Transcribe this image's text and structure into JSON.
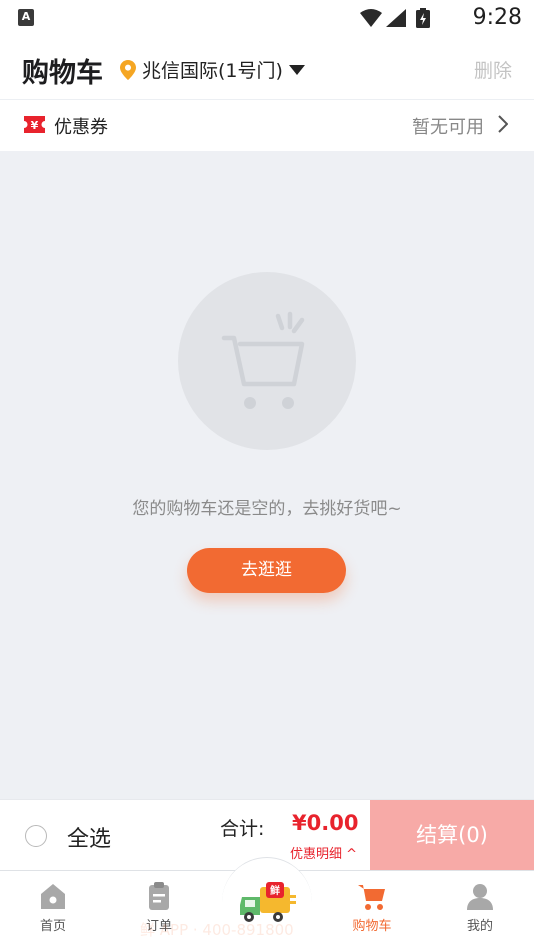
{
  "status_bar": {
    "indicator": "A",
    "time": "9:28"
  },
  "header": {
    "title": "购物车",
    "location": "兆信国际(1号门)",
    "delete_label": "删除"
  },
  "coupon": {
    "badge": "¥",
    "label": "优惠券",
    "status": "暂无可用"
  },
  "empty_state": {
    "message": "您的购物车还是空的，去挑好货吧~",
    "button_label": "去逛逛"
  },
  "checkout": {
    "select_all_label": "全选",
    "total_label": "合计:",
    "total_value": "¥0.00",
    "discount_label": "优惠明细 ^",
    "pay_label": "结算(0)"
  },
  "tabs": [
    {
      "label": "首页",
      "icon": "home-icon"
    },
    {
      "label": "订单",
      "icon": "order-icon"
    },
    {
      "label": "",
      "icon": "fresh-delivery-truck-icon",
      "badge": "鲜"
    },
    {
      "label": "购物车",
      "icon": "cart-icon",
      "active": true
    },
    {
      "label": "我的",
      "icon": "profile-icon"
    }
  ],
  "watermark": "鲜 APP · 400-891800",
  "colors": {
    "accent": "#f26a32",
    "price": "#e8232d",
    "pay_disabled": "#f7aaa7",
    "empty_bg": "#eef0f4"
  }
}
